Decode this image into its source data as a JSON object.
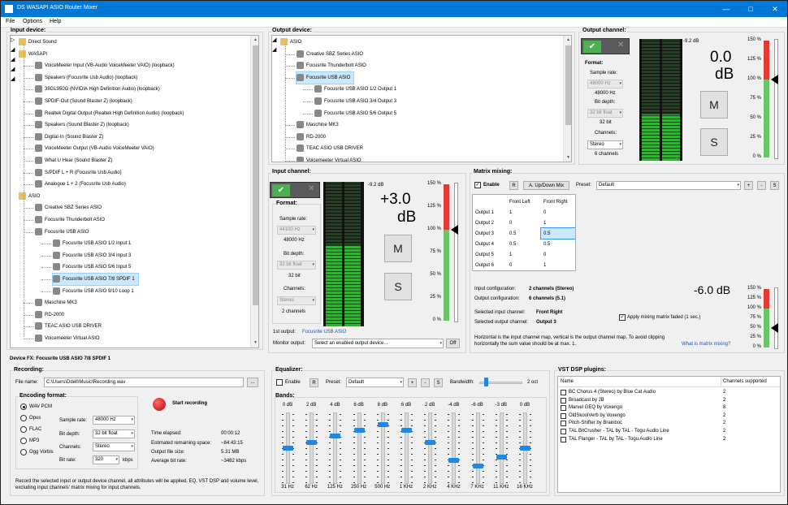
{
  "app": {
    "title": "DS WASAPI ASIO Router Mixer"
  },
  "menu": [
    "File",
    "Options",
    "Help"
  ],
  "input_device": {
    "label": "Input device:",
    "tree": [
      {
        "text": "Direct Sound",
        "level": 0,
        "type": "root",
        "expander": "▷"
      },
      {
        "text": "WASAPI",
        "level": 0,
        "type": "root",
        "expander": "◢"
      },
      {
        "text": "VoiceMeeter Input (VB-Audio VoiceMeeter VAIO) (loopback)",
        "level": 1,
        "type": "device"
      },
      {
        "text": "Speakers (Focusrite Usb Audio) (loopback)",
        "level": 1,
        "type": "device"
      },
      {
        "text": "38GL950G (NVIDIA High Definition Audio) (loopback)",
        "level": 1,
        "type": "device"
      },
      {
        "text": "SPDIF-Out (Sound Blaster Z) (loopback)",
        "level": 1,
        "type": "device"
      },
      {
        "text": "Realtek Digital Output (Realtek High Definition Audio) (loopback)",
        "level": 1,
        "type": "device"
      },
      {
        "text": "Speakers (Sound Blaster Z) (loopback)",
        "level": 1,
        "type": "device"
      },
      {
        "text": "Digital-In (Sound Blaster Z)",
        "level": 1,
        "type": "device"
      },
      {
        "text": "VoiceMeeter Output (VB-Audio VoiceMeeter VAIO)",
        "level": 1,
        "type": "device"
      },
      {
        "text": "What U Hear (Sound Blaster Z)",
        "level": 1,
        "type": "device"
      },
      {
        "text": "S/PDIF L + R (Focusrite Usb Audio)",
        "level": 1,
        "type": "device"
      },
      {
        "text": "Analogue 1 + 2 (Focusrite Usb Audio)",
        "level": 1,
        "type": "device"
      },
      {
        "text": "ASIO",
        "level": 0,
        "type": "root",
        "expander": "◢"
      },
      {
        "text": "Creative SBZ Series ASIO",
        "level": 1,
        "type": "device"
      },
      {
        "text": "Focusrite Thunderbolt ASIO",
        "level": 1,
        "type": "device"
      },
      {
        "text": "Focusrite USB ASIO",
        "level": 1,
        "type": "device",
        "expander": "◢"
      },
      {
        "text": "Focusrite USB ASIO 1/2 Input 1",
        "level": 2,
        "type": "channel"
      },
      {
        "text": "Focusrite USB ASIO 3/4 Input 3",
        "level": 2,
        "type": "channel"
      },
      {
        "text": "Focusrite USB ASIO 5/6 Input 5",
        "level": 2,
        "type": "channel"
      },
      {
        "text": "Focusrite USB ASIO 7/8 SPDIF 1",
        "level": 2,
        "type": "channel",
        "selected": true
      },
      {
        "text": "Focusrite USB ASIO 9/10 Loop 1",
        "level": 2,
        "type": "channel"
      },
      {
        "text": "Maschine MK3",
        "level": 1,
        "type": "device"
      },
      {
        "text": "RD-2000",
        "level": 1,
        "type": "device"
      },
      {
        "text": "TEAC ASIO USB DRIVER",
        "level": 1,
        "type": "device"
      },
      {
        "text": "Voicemeeter Virtual ASIO",
        "level": 1,
        "type": "device",
        "expander": "◢"
      }
    ]
  },
  "output_device": {
    "label": "Output device:",
    "tree": [
      {
        "text": "ASIO",
        "level": 0,
        "type": "root",
        "expander": "◢"
      },
      {
        "text": "Creative SBZ Series ASIO",
        "level": 1,
        "type": "device"
      },
      {
        "text": "Focusrite Thunderbolt ASIO",
        "level": 1,
        "type": "device"
      },
      {
        "text": "Focusrite USB ASIO",
        "level": 1,
        "type": "device",
        "expander": "◢",
        "selected": true
      },
      {
        "text": "Focusrite USB ASIO 1/2 Output 1",
        "level": 2,
        "type": "channel"
      },
      {
        "text": "Focusrite USB ASIO 3/4 Output 3",
        "level": 2,
        "type": "channel"
      },
      {
        "text": "Focusrite USB ASIO 5/6 Output 5",
        "level": 2,
        "type": "channel"
      },
      {
        "text": "Maschine MK3",
        "level": 1,
        "type": "device"
      },
      {
        "text": "RD-2000",
        "level": 1,
        "type": "device"
      },
      {
        "text": "TEAC ASIO USB DRIVER",
        "level": 1,
        "type": "device"
      },
      {
        "text": "Voicemeeter Virtual ASIO",
        "level": 1,
        "type": "device"
      }
    ]
  },
  "output_channel": {
    "label": "Output channel:",
    "peak": "-9.2 dB",
    "gain_value": "0.0",
    "gain_unit": "dB",
    "format_label": "Format:",
    "sample_rate_label": "Sample rate:",
    "sample_rate_combo": "48000 Hz",
    "sample_rate": "48000 Hz",
    "bit_depth_label": "Bit depth:",
    "bit_depth_combo": "32 bit float",
    "bit_depth": "32 bit",
    "channels_label": "Channels:",
    "channels_combo": "Stereo",
    "channels": "6 channels",
    "mute": "M",
    "solo": "S",
    "scale": [
      "150 %",
      "125 %",
      "100 %",
      "75 %",
      "50 %",
      "25 %",
      "0 %"
    ],
    "slider_percent": 100,
    "meter_level": [
      0.38,
      0.38
    ]
  },
  "input_channel": {
    "label": "Input channel:",
    "peak": "-9.2 dB",
    "gain_value": "+3.0",
    "gain_unit": "dB",
    "format_label": "Format:",
    "sample_rate_label": "Sample rate:",
    "sample_rate_combo": "44100 Hz",
    "sample_rate": "48000 Hz",
    "bit_depth_label": "Bit depth:",
    "bit_depth_combo": "32 bit float",
    "bit_depth": "32 bit",
    "channels_label": "Channels:",
    "channels_combo": "Stereo",
    "channels": "2 channels",
    "mute": "M",
    "solo": "S",
    "scale": [
      "150 %",
      "125 %",
      "100 %",
      "75 %",
      "50 %",
      "25 %",
      "0 %"
    ],
    "slider_percent": 100,
    "meter_level": [
      0.56,
      0.56
    ],
    "first_output_label": "1st output:",
    "first_output": "Focusrite USB ASIO",
    "monitor_label": "Monitor output:",
    "monitor_value": "Select an enabled output device...",
    "monitor_button": "Off"
  },
  "matrix": {
    "label": "Matrix mixing:",
    "enable_label": "Enable",
    "enabled": true,
    "r_button": "R",
    "updown_button": "A. Up/Down Mix",
    "preset_label": "Preset:",
    "preset_value": "Default",
    "plus": "+",
    "minus": "-",
    "s_button": "S",
    "columns": [
      "",
      "Front Left",
      "Front Right"
    ],
    "rows": [
      [
        "Output 1",
        "1",
        "0"
      ],
      [
        "Output 2",
        "0",
        "1"
      ],
      [
        "Output 3",
        "0.5",
        "0.5"
      ],
      [
        "Output 4",
        "0.5",
        "0.5"
      ],
      [
        "Output 5",
        "1",
        "0"
      ],
      [
        "Output 6",
        "0",
        "1"
      ]
    ],
    "input_config_label": "Input configuration:",
    "input_config": "2 channels (Stereo)",
    "output_config_label": "Output configuration:",
    "output_config": "6 channels (5.1)",
    "sel_input_label": "Selected input channel:",
    "sel_input": "Front Right",
    "sel_output_label": "Selected output channel:",
    "sel_output": "Output 3",
    "gain": "-6.0 dB",
    "apply_faded_label": "Apply mixing matrix faded (1 sec.)",
    "apply_faded": true,
    "help_text": "Horizontal is the input channel map, vertical is the output channel map. To avoid clipping horizontally the sum value should be at max. 1.",
    "help_link": "What is matrix mixing?",
    "scale": [
      "150 %",
      "125 %",
      "100 %",
      "75 %",
      "50 %",
      "25 %",
      "0 %"
    ],
    "slider_percent": 50
  },
  "device_fx": {
    "label": "Device FX: Focusrite USB ASIO 7/8 SPDIF 1"
  },
  "recording": {
    "label": "Recording:",
    "file_label": "File name:",
    "file_value": "C:\\Users\\Ddell\\Music\\Recording.wav",
    "browse": "...",
    "encoding_label": "Encoding format:",
    "formats": [
      "WAV PCM",
      "Opus",
      "FLAC",
      "MP3",
      "Ogg Vorbis"
    ],
    "selected_format": "WAV PCM",
    "sample_rate_label": "Sample rate:",
    "sample_rate": "48000 Hz",
    "bit_depth_label": "Bit depth:",
    "bit_depth": "32 bit float",
    "channels_label": "Channels:",
    "channels": "Stereo",
    "bitrate_label": "Bit rate:",
    "bitrate": "320",
    "bitrate_unit": "kbps",
    "start_label": "Start recording",
    "elapsed_label": "Time elapsed:",
    "elapsed": "00:00:12",
    "remaining_label": "Estimated remaining space:",
    "remaining": "~84:43:15",
    "size_label": "Output file size:",
    "size": "5.31 MB",
    "avg_label": "Average bit rate:",
    "avg": "~3482 kbps",
    "note": "Record the selected input or output device channel, all attributes will be applied, EQ, VST DSP and volume level, excluding input channels' matrix mixing for input channels."
  },
  "equalizer": {
    "label": "Equalizer:",
    "enable_label": "Enable",
    "enabled": false,
    "preset_label": "Preset:",
    "preset_value": "Default",
    "plus": "+",
    "minus": "-",
    "s_button": "S",
    "bandwidth_label": "Bandwidth:",
    "bandwidth_value": "2 oct",
    "bandwidth_fraction": 0.12,
    "bands_label": "Bands:",
    "bands": [
      {
        "gain": "0 dB",
        "freq": "31 Hz",
        "value": 0
      },
      {
        "gain": "2 dB",
        "freq": "62 Hz",
        "value": 2
      },
      {
        "gain": "4 dB",
        "freq": "125 Hz",
        "value": 4
      },
      {
        "gain": "6 dB",
        "freq": "250 Hz",
        "value": 6
      },
      {
        "gain": "8 dB",
        "freq": "500 Hz",
        "value": 8
      },
      {
        "gain": "6 dB",
        "freq": "1 KHz",
        "value": 6
      },
      {
        "gain": "2 dB",
        "freq": "2 KHz",
        "value": 2
      },
      {
        "gain": "-4 dB",
        "freq": "4 KHz",
        "value": -4
      },
      {
        "gain": "-6 dB",
        "freq": "7 KHz",
        "value": -6
      },
      {
        "gain": "-3 dB",
        "freq": "11 KHz",
        "value": -3
      },
      {
        "gain": "0 dB",
        "freq": "16 KHz",
        "value": 0
      }
    ]
  },
  "vst": {
    "label": "VST DSP plugins:",
    "col_name": "Name",
    "col_channels": "Channels supported",
    "plugins": [
      {
        "name": "BC Chorus 4 (Stereo) by Blue Cat Audio",
        "channels": "2"
      },
      {
        "name": "Broadcast by JB",
        "channels": "2"
      },
      {
        "name": "Marvel GEQ by Voxengo",
        "channels": "8"
      },
      {
        "name": "OldSkoolVerb by Voxengo",
        "channels": "2"
      },
      {
        "name": "Pitch-Shifter by Brainboc",
        "channels": "2"
      },
      {
        "name": "TAL BitCrusher - TAL by TAL - Togu Audio Line",
        "channels": "2"
      },
      {
        "name": "TAL Flanger - TAL by TAL - Togu Audio Line",
        "channels": "2"
      }
    ]
  }
}
